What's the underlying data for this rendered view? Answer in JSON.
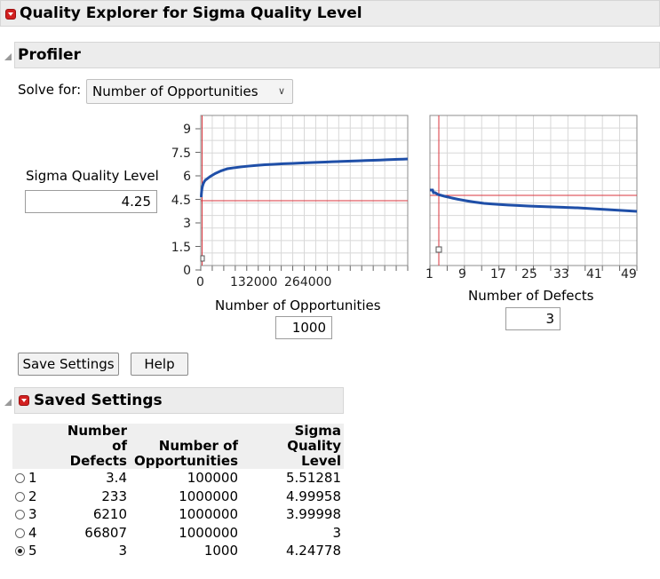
{
  "title": "Quality Explorer for Sigma Quality Level",
  "profiler": {
    "header": "Profiler",
    "solve_for_label": "Solve for:",
    "solve_for_value": "Number of Opportunities",
    "y_label": "Sigma Quality Level",
    "y_value": "4.25",
    "y_ticks": [
      "9",
      "7.5",
      "6",
      "4.5",
      "3",
      "1.5",
      "0"
    ],
    "plot1": {
      "x_ticks": [
        "0",
        "132000",
        "264000"
      ],
      "x_label": "Number of Opportunities",
      "x_value": "1000"
    },
    "plot2": {
      "x_ticks": [
        "1",
        "9",
        "17",
        "25",
        "33",
        "41",
        "49"
      ],
      "x_label": "Number of Defects",
      "x_value": "3"
    }
  },
  "buttons": {
    "save_settings": "Save Settings",
    "help": "Help"
  },
  "saved": {
    "header": "Saved Settings",
    "columns": [
      [
        "Number",
        "of Defects"
      ],
      [
        "Number of",
        "Opportunities"
      ],
      [
        "Sigma",
        "Quality Level"
      ]
    ],
    "rows": [
      {
        "label": "1",
        "selected": false,
        "defects": "3.4",
        "opportunities": "100000",
        "sigma": "5.51281"
      },
      {
        "label": "2",
        "selected": false,
        "defects": "233",
        "opportunities": "1000000",
        "sigma": "4.99958"
      },
      {
        "label": "3",
        "selected": false,
        "defects": "6210",
        "opportunities": "1000000",
        "sigma": "3.99998"
      },
      {
        "label": "4",
        "selected": false,
        "defects": "66807",
        "opportunities": "1000000",
        "sigma": "3"
      },
      {
        "label": "5",
        "selected": true,
        "defects": "3",
        "opportunities": "1000",
        "sigma": "4.24778"
      }
    ]
  },
  "colors": {
    "curve": "#1f4fa8",
    "crosshair": "#d9363e",
    "grid": "#d8d8d8",
    "header_bg": "#ececec",
    "menu_red": "#d22020"
  }
}
